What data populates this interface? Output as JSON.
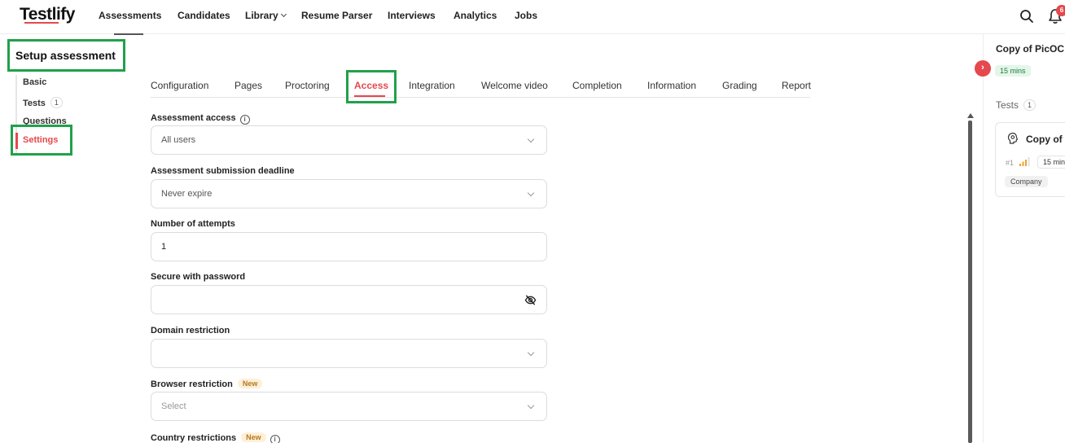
{
  "brand": {
    "logo_text": "Testlify",
    "accent_color": "#e5484d",
    "highlight_color": "#21a14a"
  },
  "topnav": {
    "items": [
      "Assessments",
      "Candidates",
      "Library",
      "Resume Parser",
      "Interviews",
      "Analytics",
      "Jobs"
    ],
    "notifications_count": "6",
    "icons": [
      "search-icon",
      "bell-icon",
      "chevron-down-icon"
    ]
  },
  "sidebar": {
    "title": "Setup assessment",
    "items": [
      {
        "label": "Basic"
      },
      {
        "label": "Tests",
        "count": "1"
      },
      {
        "label": "Questions"
      },
      {
        "label": "Settings",
        "active": true
      }
    ]
  },
  "tabs": {
    "items": [
      "Configuration",
      "Pages",
      "Proctoring",
      "Access",
      "Integration",
      "Welcome video",
      "Completion",
      "Information",
      "Grading",
      "Report"
    ],
    "active": "Access"
  },
  "form": {
    "assessment_access": {
      "label": "Assessment access",
      "info_icon": "i",
      "value": "All users"
    },
    "submission_deadline": {
      "label": "Assessment submission deadline",
      "value": "Never expire"
    },
    "attempts": {
      "label": "Number of attempts",
      "value": "1"
    },
    "password": {
      "label": "Secure with password",
      "value": ""
    },
    "domain_restriction": {
      "label": "Domain restriction",
      "value": ""
    },
    "browser_restriction": {
      "label": "Browser restriction",
      "badge": "New",
      "placeholder": "Select"
    },
    "country_restrictions": {
      "label": "Country restrictions",
      "badge": "New",
      "info_icon": "i"
    }
  },
  "right_panel": {
    "collapse_icon": "›",
    "title": "Copy of PicOC",
    "duration": "15 mins",
    "tests_label": "Tests",
    "tests_count": "1",
    "card": {
      "title": "Copy of",
      "rank": "#1",
      "duration": "15 mins",
      "tag": "Company"
    }
  }
}
